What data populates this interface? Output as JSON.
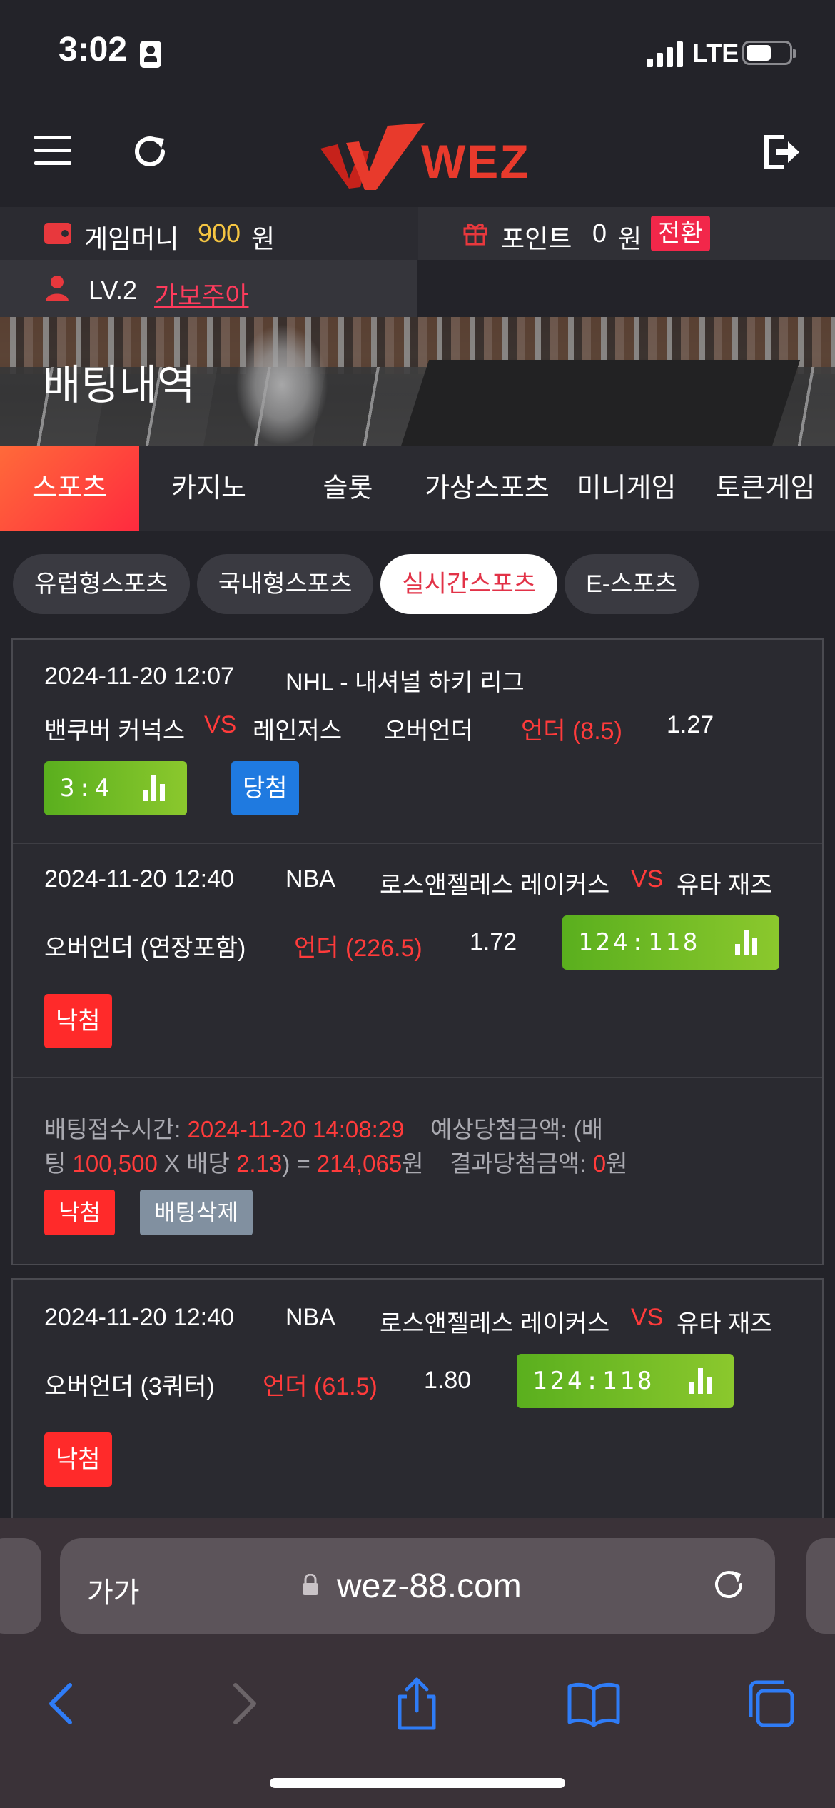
{
  "status_bar": {
    "time": "3:02",
    "network": "LTE"
  },
  "header": {
    "logo_text": "WEZ"
  },
  "account": {
    "money_label": "게임머니",
    "money_value": "900",
    "money_unit": "원",
    "point_label": "포인트",
    "point_value": "0",
    "point_unit": "원",
    "convert_label": "전환",
    "level": "LV.2",
    "nickname": "가보주아"
  },
  "banner": {
    "title": "배팅내역"
  },
  "main_tabs": [
    {
      "label": "스포츠",
      "active": true
    },
    {
      "label": "카지노",
      "active": false
    },
    {
      "label": "슬롯",
      "active": false
    },
    {
      "label": "가상스포츠",
      "active": false
    },
    {
      "label": "미니게임",
      "active": false
    },
    {
      "label": "토큰게임",
      "active": false
    }
  ],
  "sub_tabs": [
    {
      "label": "유럽형스포츠",
      "active": false
    },
    {
      "label": "국내형스포츠",
      "active": false
    },
    {
      "label": "실시간스포츠",
      "active": true
    },
    {
      "label": "E-스포츠",
      "active": false
    }
  ],
  "bets": [
    {
      "datetime": "2024-11-20 12:07",
      "league": "NHL - 내셔널 하키 리그",
      "home": "밴쿠버 커넉스",
      "vs": "VS",
      "away": "레인저스",
      "market": "오버언더",
      "pick": "언더 (8.5)",
      "odds": "1.27",
      "score": "3:4",
      "result": "당첨"
    },
    {
      "datetime": "2024-11-20 12:40",
      "league": "NBA",
      "home": "로스앤젤레스 레이커스",
      "vs": "VS",
      "away": "유타 재즈",
      "market": "오버언더 (연장포함)",
      "pick": "언더 (226.5)",
      "odds": "1.72",
      "score": "124:118",
      "result": "낙첨"
    }
  ],
  "bet_summary": {
    "accept_label": "배팅접수시간: ",
    "accept_time": "2024-11-20 14:08:29",
    "expected_label_1": "예상당첨금액: (배",
    "expected_label_2": "팅 ",
    "stake": "100,500",
    "mult_label": " X 배당 ",
    "total_odds": "2.13",
    "equals": ") = ",
    "expected_amount": "214,065",
    "won_unit": "원",
    "result_label": "결과당첨금액: ",
    "result_amount": "0",
    "result_unit": "원",
    "status_label": "낙첨",
    "delete_label": "배팅삭제"
  },
  "bet3": {
    "datetime": "2024-11-20 12:40",
    "league": "NBA",
    "home": "로스앤젤레스 레이커스",
    "vs": "VS",
    "away": "유타 재즈",
    "market": "오버언더 (3쿼터)",
    "pick": "언더 (61.5)",
    "odds": "1.80",
    "score": "124:118",
    "result": "낙첨"
  },
  "browser": {
    "text_size": "가가",
    "url": "wez-88.com"
  },
  "colors": {
    "background": "#232329",
    "accent_red": "#ff3b3b",
    "win_blue": "#1f7ae0",
    "score_green": "#6cbd24",
    "gold": "#f5c542"
  }
}
